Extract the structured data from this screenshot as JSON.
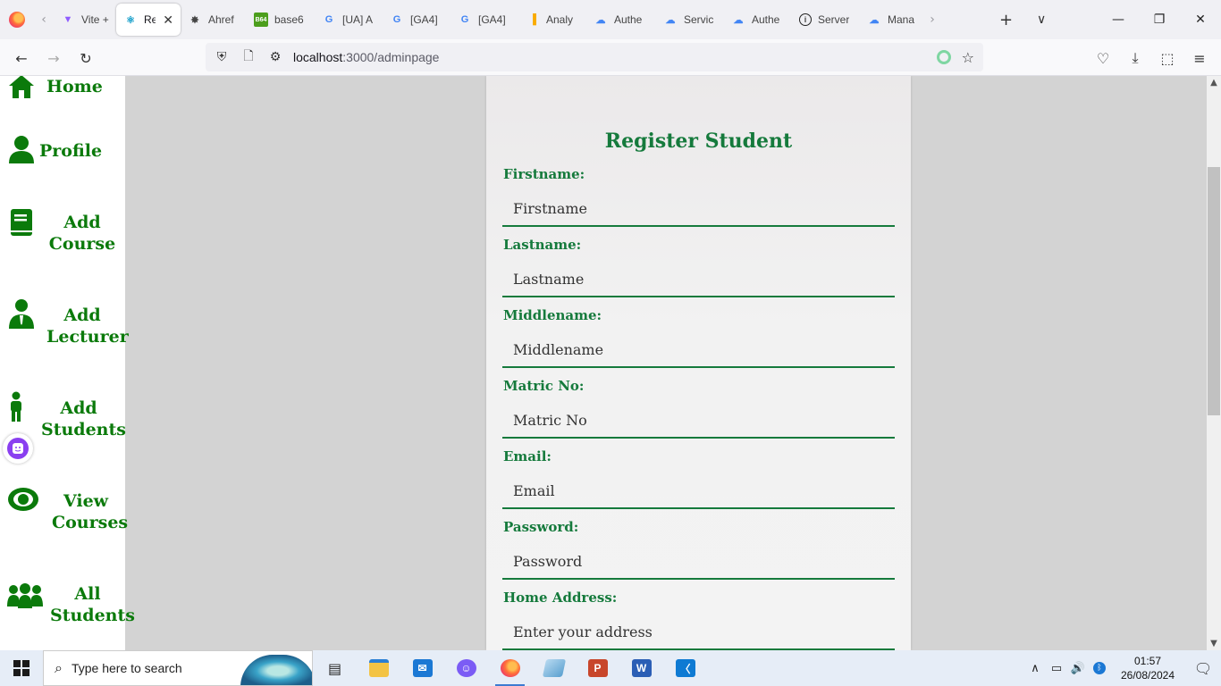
{
  "browser": {
    "tabs": [
      {
        "title": "Vite +",
        "icon": "vite-icon",
        "active": false
      },
      {
        "title": "Re",
        "icon": "react-icon",
        "active": true
      },
      {
        "title": "Ahref",
        "icon": "openai-icon",
        "active": false
      },
      {
        "title": "base6",
        "icon": "base64-icon",
        "active": false
      },
      {
        "title": "[UA] A",
        "icon": "google-icon",
        "active": false
      },
      {
        "title": "[GA4]",
        "icon": "google-icon",
        "active": false
      },
      {
        "title": "[GA4]",
        "icon": "google-icon",
        "active": false
      },
      {
        "title": "Analy",
        "icon": "analytics-icon",
        "active": false
      },
      {
        "title": "Authe",
        "icon": "gcloud-icon",
        "active": false
      },
      {
        "title": "Servic",
        "icon": "gcloud-icon",
        "active": false
      },
      {
        "title": "Authe",
        "icon": "gcloud-icon",
        "active": false
      },
      {
        "title": "Server",
        "icon": "info-icon",
        "active": false
      },
      {
        "title": "Mana",
        "icon": "gcloud-icon",
        "active": false
      }
    ],
    "url_host": "localhost",
    "url_path": ":3000/adminpage"
  },
  "sidebar": {
    "items": [
      {
        "label": "Home",
        "icon": "home-icon"
      },
      {
        "label": "Profile",
        "icon": "user-icon"
      },
      {
        "label": "Add Course",
        "line1": "Add",
        "line2": "Course",
        "icon": "book-icon"
      },
      {
        "label": "Add Lecturer",
        "line1": "Add",
        "line2": "Lecturer",
        "icon": "lecturer-icon"
      },
      {
        "label": "Add Students",
        "line1": "Add",
        "line2": "Students",
        "icon": "student-icon"
      },
      {
        "label": "View Courses",
        "line1": "View",
        "line2": "Courses",
        "icon": "eye-icon"
      },
      {
        "label": "All Students",
        "line1": "All",
        "line2": "Students",
        "icon": "users-icon"
      }
    ]
  },
  "form": {
    "title": "Register Student",
    "fields": [
      {
        "label": "Firstname:",
        "placeholder": "Firstname"
      },
      {
        "label": "Lastname:",
        "placeholder": "Lastname"
      },
      {
        "label": "Middlename:",
        "placeholder": "Middlename"
      },
      {
        "label": "Matric No:",
        "placeholder": "Matric No"
      },
      {
        "label": "Email:",
        "placeholder": "Email"
      },
      {
        "label": "Password:",
        "placeholder": "Password"
      },
      {
        "label": "Home Address:",
        "placeholder": "Enter your address"
      }
    ]
  },
  "taskbar": {
    "search_placeholder": "Type here to search",
    "time": "01:57",
    "date": "26/08/2024"
  },
  "colors": {
    "sidebar_green": "#0b7a0b",
    "form_green": "#157a3c",
    "page_bg": "#d3d3d3"
  }
}
